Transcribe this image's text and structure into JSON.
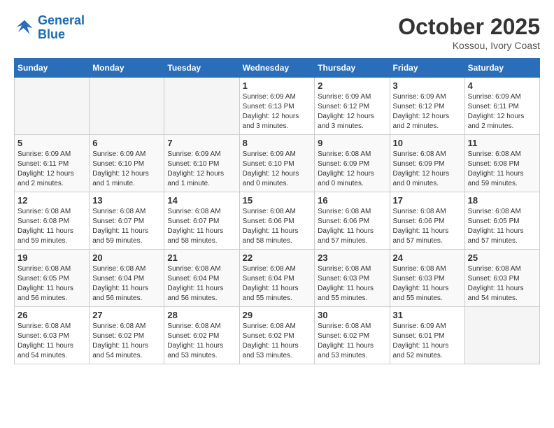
{
  "logo": {
    "line1": "General",
    "line2": "Blue"
  },
  "title": "October 2025",
  "location": "Kossou, Ivory Coast",
  "days_of_week": [
    "Sunday",
    "Monday",
    "Tuesday",
    "Wednesday",
    "Thursday",
    "Friday",
    "Saturday"
  ],
  "weeks": [
    [
      {
        "num": "",
        "info": ""
      },
      {
        "num": "",
        "info": ""
      },
      {
        "num": "",
        "info": ""
      },
      {
        "num": "1",
        "info": "Sunrise: 6:09 AM\nSunset: 6:13 PM\nDaylight: 12 hours and 3 minutes."
      },
      {
        "num": "2",
        "info": "Sunrise: 6:09 AM\nSunset: 6:12 PM\nDaylight: 12 hours and 3 minutes."
      },
      {
        "num": "3",
        "info": "Sunrise: 6:09 AM\nSunset: 6:12 PM\nDaylight: 12 hours and 2 minutes."
      },
      {
        "num": "4",
        "info": "Sunrise: 6:09 AM\nSunset: 6:11 PM\nDaylight: 12 hours and 2 minutes."
      }
    ],
    [
      {
        "num": "5",
        "info": "Sunrise: 6:09 AM\nSunset: 6:11 PM\nDaylight: 12 hours and 2 minutes."
      },
      {
        "num": "6",
        "info": "Sunrise: 6:09 AM\nSunset: 6:10 PM\nDaylight: 12 hours and 1 minute."
      },
      {
        "num": "7",
        "info": "Sunrise: 6:09 AM\nSunset: 6:10 PM\nDaylight: 12 hours and 1 minute."
      },
      {
        "num": "8",
        "info": "Sunrise: 6:09 AM\nSunset: 6:10 PM\nDaylight: 12 hours and 0 minutes."
      },
      {
        "num": "9",
        "info": "Sunrise: 6:08 AM\nSunset: 6:09 PM\nDaylight: 12 hours and 0 minutes."
      },
      {
        "num": "10",
        "info": "Sunrise: 6:08 AM\nSunset: 6:09 PM\nDaylight: 12 hours and 0 minutes."
      },
      {
        "num": "11",
        "info": "Sunrise: 6:08 AM\nSunset: 6:08 PM\nDaylight: 11 hours and 59 minutes."
      }
    ],
    [
      {
        "num": "12",
        "info": "Sunrise: 6:08 AM\nSunset: 6:08 PM\nDaylight: 11 hours and 59 minutes."
      },
      {
        "num": "13",
        "info": "Sunrise: 6:08 AM\nSunset: 6:07 PM\nDaylight: 11 hours and 59 minutes."
      },
      {
        "num": "14",
        "info": "Sunrise: 6:08 AM\nSunset: 6:07 PM\nDaylight: 11 hours and 58 minutes."
      },
      {
        "num": "15",
        "info": "Sunrise: 6:08 AM\nSunset: 6:06 PM\nDaylight: 11 hours and 58 minutes."
      },
      {
        "num": "16",
        "info": "Sunrise: 6:08 AM\nSunset: 6:06 PM\nDaylight: 11 hours and 57 minutes."
      },
      {
        "num": "17",
        "info": "Sunrise: 6:08 AM\nSunset: 6:06 PM\nDaylight: 11 hours and 57 minutes."
      },
      {
        "num": "18",
        "info": "Sunrise: 6:08 AM\nSunset: 6:05 PM\nDaylight: 11 hours and 57 minutes."
      }
    ],
    [
      {
        "num": "19",
        "info": "Sunrise: 6:08 AM\nSunset: 6:05 PM\nDaylight: 11 hours and 56 minutes."
      },
      {
        "num": "20",
        "info": "Sunrise: 6:08 AM\nSunset: 6:04 PM\nDaylight: 11 hours and 56 minutes."
      },
      {
        "num": "21",
        "info": "Sunrise: 6:08 AM\nSunset: 6:04 PM\nDaylight: 11 hours and 56 minutes."
      },
      {
        "num": "22",
        "info": "Sunrise: 6:08 AM\nSunset: 6:04 PM\nDaylight: 11 hours and 55 minutes."
      },
      {
        "num": "23",
        "info": "Sunrise: 6:08 AM\nSunset: 6:03 PM\nDaylight: 11 hours and 55 minutes."
      },
      {
        "num": "24",
        "info": "Sunrise: 6:08 AM\nSunset: 6:03 PM\nDaylight: 11 hours and 55 minutes."
      },
      {
        "num": "25",
        "info": "Sunrise: 6:08 AM\nSunset: 6:03 PM\nDaylight: 11 hours and 54 minutes."
      }
    ],
    [
      {
        "num": "26",
        "info": "Sunrise: 6:08 AM\nSunset: 6:03 PM\nDaylight: 11 hours and 54 minutes."
      },
      {
        "num": "27",
        "info": "Sunrise: 6:08 AM\nSunset: 6:02 PM\nDaylight: 11 hours and 54 minutes."
      },
      {
        "num": "28",
        "info": "Sunrise: 6:08 AM\nSunset: 6:02 PM\nDaylight: 11 hours and 53 minutes."
      },
      {
        "num": "29",
        "info": "Sunrise: 6:08 AM\nSunset: 6:02 PM\nDaylight: 11 hours and 53 minutes."
      },
      {
        "num": "30",
        "info": "Sunrise: 6:08 AM\nSunset: 6:02 PM\nDaylight: 11 hours and 53 minutes."
      },
      {
        "num": "31",
        "info": "Sunrise: 6:09 AM\nSunset: 6:01 PM\nDaylight: 11 hours and 52 minutes."
      },
      {
        "num": "",
        "info": ""
      }
    ]
  ]
}
